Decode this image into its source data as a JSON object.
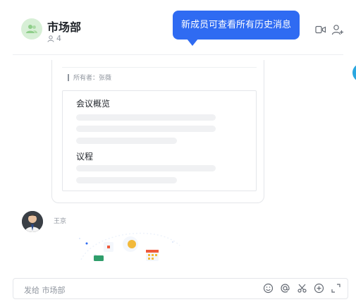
{
  "chat": {
    "title": "市场部",
    "member_count": "4"
  },
  "tooltip": {
    "text": "新成员可查看所有历史消息"
  },
  "doc": {
    "owner": "所有者：张薇",
    "section1_title": "会议概览",
    "section2_title": "议程"
  },
  "sender": {
    "name": "王京"
  },
  "input": {
    "placeholder": "发给 市场部"
  },
  "icons": {
    "group_avatar": "group-icon",
    "member": "person-icon",
    "video": "video-call-icon",
    "add_member": "add-member-icon",
    "emoji": "emoji-icon",
    "mention": "at-icon",
    "scissors": "scissors-icon",
    "plus": "plus-circle-icon",
    "expand": "expand-icon"
  },
  "colors": {
    "accent": "#2f6bf2",
    "group_avatar_bg": "#d7efd6"
  }
}
